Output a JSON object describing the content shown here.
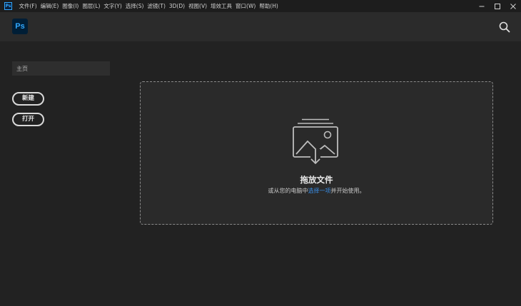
{
  "menubar": {
    "app_icon_text": "Ps",
    "items": [
      "文件(F)",
      "编辑(E)",
      "图像(I)",
      "图层(L)",
      "文字(Y)",
      "选择(S)",
      "滤镜(T)",
      "3D(D)",
      "视图(V)",
      "增效工具",
      "窗口(W)",
      "帮助(H)"
    ]
  },
  "header": {
    "logo_text": "Ps"
  },
  "sidebar": {
    "search_placeholder": "主页",
    "new_label": "新建",
    "open_label": "打开"
  },
  "dropzone": {
    "title": "拖放文件",
    "sub_prefix": "或从您的电脑中",
    "sub_link": "选择一项",
    "sub_suffix": "并开始使用。"
  },
  "colors": {
    "accent": "#31a8ff",
    "link": "#3a8fe8",
    "background": "#222222"
  }
}
